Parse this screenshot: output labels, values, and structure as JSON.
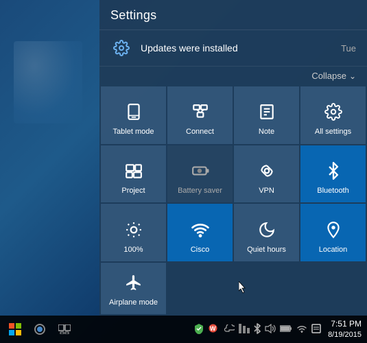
{
  "desktop": {},
  "action_center": {
    "title": "Settings",
    "notification": {
      "text": "Updates were installed",
      "day": "Tue"
    },
    "collapse_label": "Collapse",
    "tiles": [
      {
        "id": "tablet-mode",
        "label": "Tablet mode",
        "icon": "tablet",
        "active": false
      },
      {
        "id": "connect",
        "label": "Connect",
        "icon": "connect",
        "active": false
      },
      {
        "id": "note",
        "label": "Note",
        "icon": "note",
        "active": false
      },
      {
        "id": "all-settings",
        "label": "All settings",
        "icon": "settings",
        "active": false
      },
      {
        "id": "project",
        "label": "Project",
        "icon": "project",
        "active": false
      },
      {
        "id": "battery-saver",
        "label": "Battery saver",
        "icon": "battery",
        "active": false,
        "disabled": true
      },
      {
        "id": "vpn",
        "label": "VPN",
        "icon": "vpn",
        "active": false
      },
      {
        "id": "bluetooth",
        "label": "Bluetooth",
        "icon": "bluetooth",
        "active": true
      },
      {
        "id": "brightness",
        "label": "100%",
        "icon": "brightness",
        "active": false
      },
      {
        "id": "cisco",
        "label": "Cisco",
        "icon": "wifi-cisco",
        "active": true
      },
      {
        "id": "quiet-hours",
        "label": "Quiet hours",
        "icon": "moon",
        "active": false
      },
      {
        "id": "location",
        "label": "Location",
        "icon": "location",
        "active": true
      }
    ],
    "last_row": [
      {
        "id": "airplane-mode",
        "label": "Airplane mode",
        "icon": "airplane",
        "active": false
      }
    ]
  },
  "taskbar": {
    "time": "7:51 PM",
    "date": "8/19/2015",
    "sys_icons": [
      "defender",
      "store",
      "onedrive",
      "taskview",
      "bluetooth-sys",
      "volume",
      "battery-sys",
      "wifi-sys",
      "action-center"
    ]
  }
}
